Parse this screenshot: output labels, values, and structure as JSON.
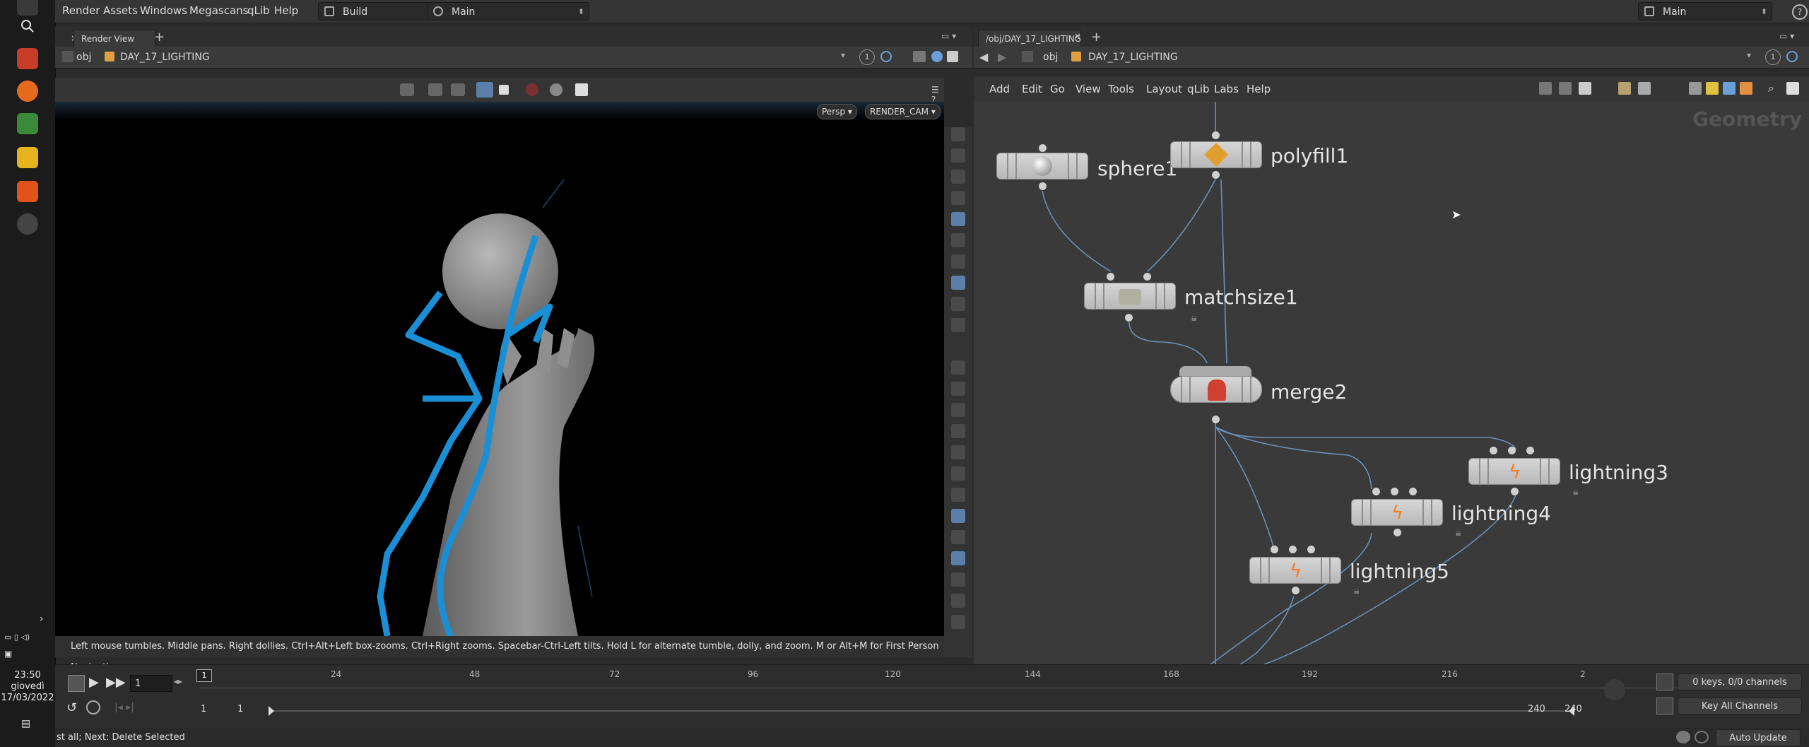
{
  "taskbar": {
    "clock_time": "23:50",
    "clock_day": "giovedì",
    "clock_date": "17/03/2022"
  },
  "menubar": {
    "items": [
      "Render",
      "Assets",
      "Windows",
      "Megascans",
      "qLib",
      "Help"
    ],
    "desktop_combo": "Build",
    "layout_combo": "Main",
    "right_combo": "Main"
  },
  "left_panel": {
    "tab_render_view": "Render View",
    "path_root": "obj",
    "path_node": "DAY_17_LIGHTING",
    "persp_label": "Persp",
    "camera_label": "RENDER_CAM",
    "vp_counter": "1",
    "hint": "Left mouse tumbles. Middle pans. Right dollies. Ctrl+Alt+Left box-zooms. Ctrl+Right zooms. Spacebar-Ctrl-Left tilts. Hold L for alternate tumble, dolly, and zoom.    M or Alt+M for First Person Navigation."
  },
  "right_panel": {
    "tab_label": "/obj/DAY_17_LIGHTING",
    "path_root": "obj",
    "path_node": "DAY_17_LIGHTING",
    "counter": "1",
    "menu": [
      "Add",
      "Edit",
      "Go",
      "View",
      "Tools",
      "Layout",
      "qLib",
      "Labs",
      "Help"
    ],
    "context_label": "Geometry",
    "nodes": {
      "sphere1": "sphere1",
      "polyfill1": "polyfill1",
      "matchsize1": "matchsize1",
      "merge2": "merge2",
      "lightning3": "lightning3",
      "lightning4": "lightning4",
      "lightning5": "lightning5"
    }
  },
  "timeline": {
    "ticks": [
      "24",
      "48",
      "72",
      "96",
      "120",
      "144",
      "168",
      "192",
      "216",
      "2"
    ],
    "current_frame": "1",
    "frame_marker": "1",
    "range_start": "1",
    "range_start2": "1",
    "range_end": "240",
    "range_end2": "240",
    "keys_label": "0 keys, 0/0 channels",
    "key_all_label": "Key All Channels"
  },
  "status": {
    "message": "st all; Next: Delete Selected",
    "auto_update": "Auto Update"
  },
  "colors": {
    "accent_blue": "#1a8fd6",
    "node_body": "#c8c8c8",
    "lightning_orange": "#ff7a1a"
  }
}
